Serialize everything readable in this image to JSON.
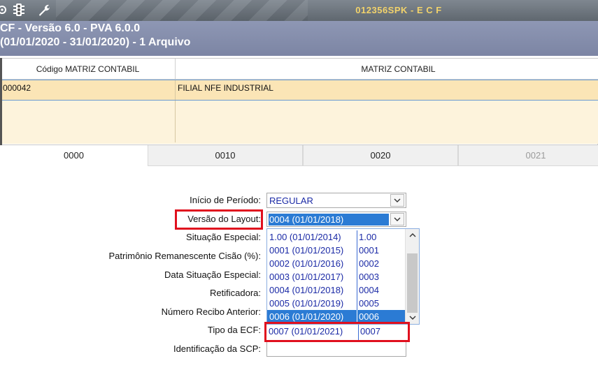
{
  "toolbar": {
    "icons": [
      "settings-icon",
      "traffic-light-icon",
      "wrench-icon"
    ],
    "app_title": "012356SPK - E C F"
  },
  "header": {
    "line1": "CF - Versão 6.0 - PVA 6.0.0",
    "line2": "(01/01/2020 - 31/01/2020) - 1 Arquivo"
  },
  "grid": {
    "columns": [
      "Código MATRIZ CONTABIL",
      "MATRIZ CONTABIL"
    ],
    "rows": [
      {
        "code": "000042",
        "name": "FILIAL NFE INDUSTRIAL"
      }
    ]
  },
  "tabs": [
    {
      "label": "0000",
      "state": "active"
    },
    {
      "label": "0010",
      "state": "normal"
    },
    {
      "label": "0020",
      "state": "normal"
    },
    {
      "label": "0021",
      "state": "disabled"
    }
  ],
  "form": {
    "inicio_periodo": {
      "label": "Início de Período:",
      "value": "REGULAR"
    },
    "versao_layout": {
      "label": "Versão do Layout:",
      "value": "0004 (01/01/2018)"
    },
    "situacao_especial": {
      "label": "Situação Especial:"
    },
    "patrimonio": {
      "label": "Patrimônio Remanescente Cisão (%):"
    },
    "data_situacao": {
      "label": "Data Situação Especial:"
    },
    "retificadora": {
      "label": "Retificadora:"
    },
    "numero_recibo": {
      "label": "Número Recibo Anterior:"
    },
    "tipo_ecf": {
      "label": "Tipo da ECF:"
    },
    "identificacao_scp": {
      "label": "Identificação da SCP:"
    }
  },
  "dropdown": {
    "options": [
      {
        "text": "1.00 (01/01/2014)",
        "code": "1.00"
      },
      {
        "text": "0001 (01/01/2015)",
        "code": "0001"
      },
      {
        "text": "0002 (01/01/2016)",
        "code": "0002"
      },
      {
        "text": "0003 (01/01/2017)",
        "code": "0003"
      },
      {
        "text": "0004 (01/01/2018)",
        "code": "0004"
      },
      {
        "text": "0005 (01/01/2019)",
        "code": "0005"
      },
      {
        "text": "0006 (01/01/2020)",
        "code": "0006"
      }
    ],
    "selected_index": 6,
    "extra_option": {
      "text": "0007 (01/01/2021)",
      "code": "0007"
    }
  },
  "colors": {
    "highlight_box": "#e0101e",
    "selection": "#2b7bd4",
    "option_text": "#1b2aa6",
    "title_text": "#f2d36b"
  }
}
